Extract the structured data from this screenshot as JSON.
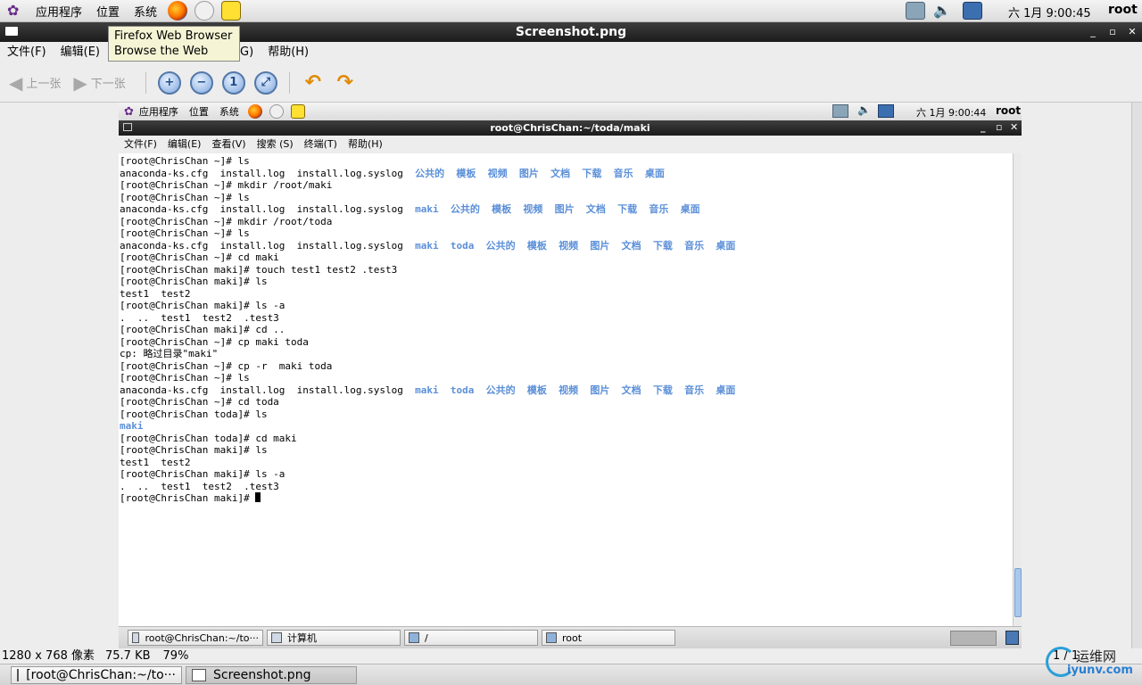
{
  "top_panel": {
    "menus": [
      "应用程序",
      "位置",
      "系统"
    ],
    "clock": "六 1月  9:00:45",
    "user": "root"
  },
  "tooltip": {
    "line1": "Firefox Web Browser",
    "line2": "Browse the Web"
  },
  "window": {
    "title": "Screenshot.png",
    "min": "_",
    "max": "▫",
    "close": "✕"
  },
  "viewer_menu": [
    "文件(F)",
    "编辑(E)",
    "(G)",
    "帮助(H)"
  ],
  "toolbar": {
    "prev": "上一张",
    "next": "下一张",
    "zoom_in": "+",
    "zoom_out": "−",
    "zoom_normal": "1",
    "zoom_fit": "⤢"
  },
  "inner": {
    "panel": {
      "menus": [
        "应用程序",
        "位置",
        "系统"
      ],
      "clock": "六 1月  9:00:44",
      "user": "root"
    },
    "title": "root@ChrisChan:~/toda/maki",
    "menu": [
      "文件(F)",
      "编辑(E)",
      "查看(V)",
      "搜索 (S)",
      "终端(T)",
      "帮助(H)"
    ],
    "taskbar": [
      "root@ChrisChan:~/to···",
      "计算机",
      "/",
      "root"
    ]
  },
  "terminal": {
    "lines": [
      [
        {
          "t": "[root@ChrisChan ~]# ls"
        }
      ],
      [
        {
          "t": "anaconda-ks.cfg  install.log  install.log.syslog  "
        },
        {
          "t": "公共的  模板  视频  图片  文档  下载  音乐  桌面",
          "d": 1
        }
      ],
      [
        {
          "t": "[root@ChrisChan ~]# mkdir /root/maki"
        }
      ],
      [
        {
          "t": "[root@ChrisChan ~]# ls"
        }
      ],
      [
        {
          "t": "anaconda-ks.cfg  install.log  install.log.syslog  "
        },
        {
          "t": "maki  公共的  模板  视频  图片  文档  下载  音乐  桌面",
          "d": 1
        }
      ],
      [
        {
          "t": "[root@ChrisChan ~]# mkdir /root/toda"
        }
      ],
      [
        {
          "t": "[root@ChrisChan ~]# ls"
        }
      ],
      [
        {
          "t": "anaconda-ks.cfg  install.log  install.log.syslog  "
        },
        {
          "t": "maki  toda  公共的  模板  视频  图片  文档  下载  音乐  桌面",
          "d": 1
        }
      ],
      [
        {
          "t": "[root@ChrisChan ~]# cd maki"
        }
      ],
      [
        {
          "t": "[root@ChrisChan maki]# touch test1 test2 .test3"
        }
      ],
      [
        {
          "t": "[root@ChrisChan maki]# ls"
        }
      ],
      [
        {
          "t": "test1  test2"
        }
      ],
      [
        {
          "t": "[root@ChrisChan maki]# ls -a"
        }
      ],
      [
        {
          "t": ".  ..  test1  test2  .test3"
        }
      ],
      [
        {
          "t": "[root@ChrisChan maki]# cd .."
        }
      ],
      [
        {
          "t": "[root@ChrisChan ~]# cp maki toda"
        }
      ],
      [
        {
          "t": "cp: 略过目录\"maki\""
        }
      ],
      [
        {
          "t": "[root@ChrisChan ~]# cp -r  maki toda"
        }
      ],
      [
        {
          "t": "[root@ChrisChan ~]# ls"
        }
      ],
      [
        {
          "t": "anaconda-ks.cfg  install.log  install.log.syslog  "
        },
        {
          "t": "maki  toda  公共的  模板  视频  图片  文档  下载  音乐  桌面",
          "d": 1
        }
      ],
      [
        {
          "t": "[root@ChrisChan ~]# cd toda"
        }
      ],
      [
        {
          "t": "[root@ChrisChan toda]# ls"
        }
      ],
      [
        {
          "t": "maki",
          "d": 1
        }
      ],
      [
        {
          "t": "[root@ChrisChan toda]# cd maki"
        }
      ],
      [
        {
          "t": "[root@ChrisChan maki]# ls"
        }
      ],
      [
        {
          "t": "test1  test2"
        }
      ],
      [
        {
          "t": "[root@ChrisChan maki]# ls -a"
        }
      ],
      [
        {
          "t": ".  ..  test1  test2  .test3"
        }
      ],
      [
        {
          "t": "[root@ChrisChan maki]# "
        },
        {
          "c": 1
        }
      ]
    ]
  },
  "status_bar": {
    "dimensions": "1280 x 768 像素",
    "size": "75.7 KB",
    "zoom": "79%",
    "page": "1 / 1"
  },
  "taskbar": [
    "[root@ChrisChan:~/to···",
    "Screenshot.png"
  ],
  "watermark": {
    "brand": "运维网",
    "site": "iyunv.com"
  },
  "colors": {
    "dir": "#5b8fd8",
    "titlebar": "#1b1b1b",
    "tooltip": "#f5f5d5"
  }
}
